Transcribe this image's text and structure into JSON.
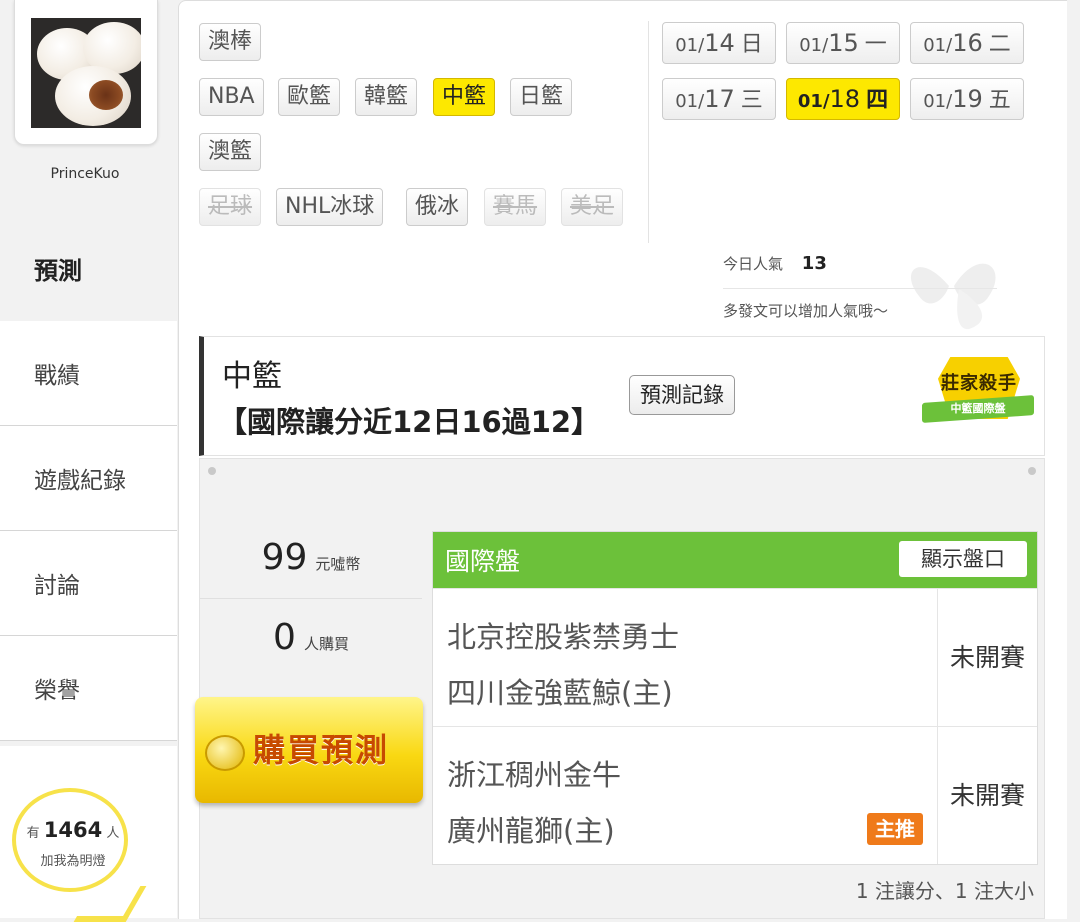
{
  "profile": {
    "username": "PrinceKuo"
  },
  "nav": [
    {
      "label": "預測",
      "active": true
    },
    {
      "label": "戰績"
    },
    {
      "label": "遊戲紀錄"
    },
    {
      "label": "討論"
    },
    {
      "label": "榮譽"
    }
  ],
  "fans": {
    "prefix": "有",
    "count": "1464",
    "suffix": "人",
    "sub": "加我為明燈"
  },
  "sports": [
    {
      "label": "澳棒"
    },
    {
      "label": "NBA"
    },
    {
      "label": "歐籃"
    },
    {
      "label": "韓籃"
    },
    {
      "label": "中籃",
      "active": true
    },
    {
      "label": "日籃"
    },
    {
      "label": "澳籃"
    },
    {
      "label": "足球",
      "disabled": true
    },
    {
      "label": "NHL冰球"
    },
    {
      "label": "俄冰"
    },
    {
      "label": "賽馬",
      "disabled": true
    },
    {
      "label": "美足",
      "disabled": true
    }
  ],
  "dates": [
    {
      "md_prefix": "01/",
      "md_day": "14",
      "weekday": "日"
    },
    {
      "md_prefix": "01/",
      "md_day": "15",
      "weekday": "一"
    },
    {
      "md_prefix": "01/",
      "md_day": "16",
      "weekday": "二"
    },
    {
      "md_prefix": "01/",
      "md_day": "17",
      "weekday": "三"
    },
    {
      "md_prefix": "01/",
      "md_day": "18",
      "weekday": "四",
      "active": true
    },
    {
      "md_prefix": "01/",
      "md_day": "19",
      "weekday": "五"
    }
  ],
  "popularity": {
    "label": "今日人氣",
    "value": "13",
    "tip": "多發文可以增加人氣哦～"
  },
  "header": {
    "category": "中籃",
    "record": "【國際讓分近12日16過12】",
    "record_button": "預測記錄",
    "badge_title": "莊家殺手",
    "badge_sub": "中籃國際盤"
  },
  "purchase": {
    "price": "99",
    "price_unit": "元噓幣",
    "buyers": "0",
    "buyers_unit": "人購買",
    "buy_button": "購買預測"
  },
  "games": {
    "title": "國際盤",
    "show_button": "顯示盤口",
    "matches": [
      {
        "away": "北京控股紫禁勇士",
        "home": "四川金強藍鯨(主)",
        "status": "未開賽"
      },
      {
        "away": "浙江稠州金牛",
        "home": "廣州龍獅(主)",
        "status": "未開賽",
        "tag": "主推"
      }
    ],
    "summary": "1 注讓分、1 注大小"
  },
  "colors": {
    "accent_yellow": "#fde800",
    "table_green": "#6cc13a",
    "tag_orange": "#ef7a1a"
  }
}
